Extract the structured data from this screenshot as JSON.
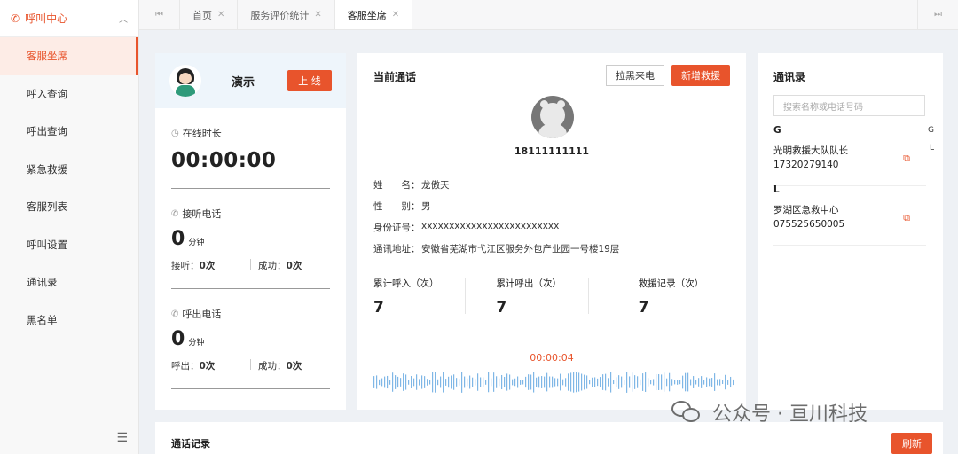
{
  "sidebar": {
    "header": "呼叫中心",
    "items": [
      {
        "label": "客服坐席",
        "active": true
      },
      {
        "label": "呼入查询"
      },
      {
        "label": "呼出查询"
      },
      {
        "label": "紧急救援"
      },
      {
        "label": "客服列表"
      },
      {
        "label": "呼叫设置"
      },
      {
        "label": "通讯录"
      },
      {
        "label": "黑名单"
      }
    ]
  },
  "tabs": [
    {
      "label": "首页"
    },
    {
      "label": "服务评价统计"
    },
    {
      "label": "客服坐席",
      "active": true
    }
  ],
  "agent": {
    "name": "演示",
    "online_button": "上 线",
    "online_label": "在线时长",
    "online_time": "00:00:00",
    "incoming": {
      "label": "接听电话",
      "minutes": "0",
      "unit": "分钟",
      "answer_label": "接听：",
      "answer_value": "0次",
      "success_label": "成功：",
      "success_value": "0次"
    },
    "outgoing": {
      "label": "呼出电话",
      "minutes": "0",
      "unit": "分钟",
      "call_label": "呼出：",
      "call_value": "0次",
      "success_label": "成功：",
      "success_value": "0次"
    }
  },
  "current_call": {
    "title": "当前通话",
    "blacklist_button": "拉黑来电",
    "rescue_button": "新增救援",
    "phone": "18111111111",
    "fields": [
      {
        "key": "姓　　名：",
        "value": "龙傲天"
      },
      {
        "key": "性　　别：",
        "value": "男"
      },
      {
        "key": "身份证号：",
        "value": "xxxxxxxxxxxxxxxxxxxxxxxxx"
      },
      {
        "key": "通讯地址：",
        "value": "安徽省芜湖市弋江区服务外包产业园一号楼19层"
      }
    ],
    "totals": [
      {
        "label": "累计呼入（次）",
        "value": "7"
      },
      {
        "label": "累计呼出（次）",
        "value": "7"
      },
      {
        "label": "救援记录（次）",
        "value": "7"
      }
    ],
    "timer": "00:00:04"
  },
  "contacts": {
    "title": "通讯录",
    "search_placeholder": "搜索名称或电话号码",
    "index": [
      "G",
      "L"
    ],
    "groups": [
      {
        "letter": "G",
        "name": "光明救援大队队长",
        "phone": "17320279140"
      },
      {
        "letter": "L",
        "name": "罗湖区急救中心",
        "phone": "075525650005"
      }
    ]
  },
  "call_log": {
    "title": "通话记录",
    "refresh_button": "刷新"
  },
  "watermark": "公众号 · 亘川科技",
  "colors": {
    "accent": "#e8542c"
  }
}
